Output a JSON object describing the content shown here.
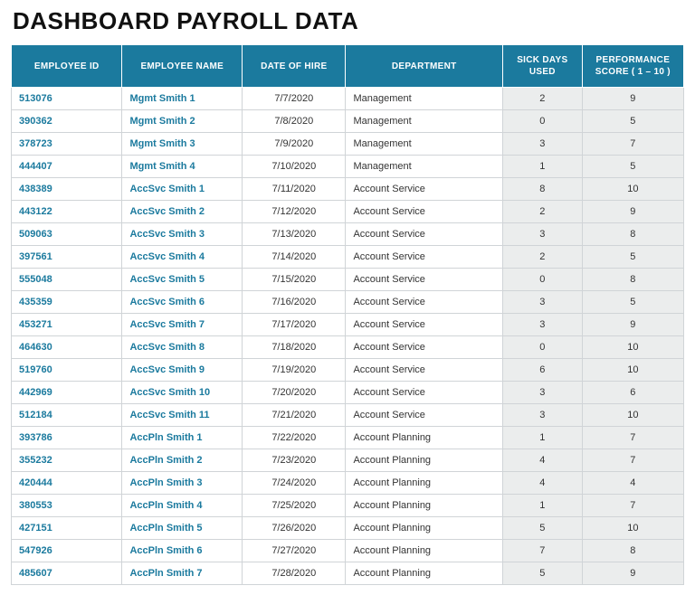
{
  "title": "DASHBOARD PAYROLL DATA",
  "headers": {
    "employee_id": "EMPLOYEE ID",
    "employee_name": "EMPLOYEE NAME",
    "date_of_hire": "DATE OF HIRE",
    "department": "DEPARTMENT",
    "sick_days": "SICK DAYS USED",
    "performance": "PERFORMANCE SCORE ( 1 – 10 )"
  },
  "rows": [
    {
      "id": "513076",
      "name": "Mgmt Smith 1",
      "date": "7/7/2020",
      "dept": "Management",
      "sick": "2",
      "perf": "9"
    },
    {
      "id": "390362",
      "name": "Mgmt Smith 2",
      "date": "7/8/2020",
      "dept": "Management",
      "sick": "0",
      "perf": "5"
    },
    {
      "id": "378723",
      "name": "Mgmt Smith 3",
      "date": "7/9/2020",
      "dept": "Management",
      "sick": "3",
      "perf": "7"
    },
    {
      "id": "444407",
      "name": "Mgmt Smith 4",
      "date": "7/10/2020",
      "dept": "Management",
      "sick": "1",
      "perf": "5"
    },
    {
      "id": "438389",
      "name": "AccSvc Smith 1",
      "date": "7/11/2020",
      "dept": "Account Service",
      "sick": "8",
      "perf": "10"
    },
    {
      "id": "443122",
      "name": "AccSvc Smith 2",
      "date": "7/12/2020",
      "dept": "Account Service",
      "sick": "2",
      "perf": "9"
    },
    {
      "id": "509063",
      "name": "AccSvc Smith 3",
      "date": "7/13/2020",
      "dept": "Account Service",
      "sick": "3",
      "perf": "8"
    },
    {
      "id": "397561",
      "name": "AccSvc Smith 4",
      "date": "7/14/2020",
      "dept": "Account Service",
      "sick": "2",
      "perf": "5"
    },
    {
      "id": "555048",
      "name": "AccSvc Smith 5",
      "date": "7/15/2020",
      "dept": "Account Service",
      "sick": "0",
      "perf": "8"
    },
    {
      "id": "435359",
      "name": "AccSvc Smith 6",
      "date": "7/16/2020",
      "dept": "Account Service",
      "sick": "3",
      "perf": "5"
    },
    {
      "id": "453271",
      "name": "AccSvc Smith 7",
      "date": "7/17/2020",
      "dept": "Account Service",
      "sick": "3",
      "perf": "9"
    },
    {
      "id": "464630",
      "name": "AccSvc Smith 8",
      "date": "7/18/2020",
      "dept": "Account Service",
      "sick": "0",
      "perf": "10"
    },
    {
      "id": "519760",
      "name": "AccSvc Smith 9",
      "date": "7/19/2020",
      "dept": "Account Service",
      "sick": "6",
      "perf": "10"
    },
    {
      "id": "442969",
      "name": "AccSvc Smith 10",
      "date": "7/20/2020",
      "dept": "Account Service",
      "sick": "3",
      "perf": "6"
    },
    {
      "id": "512184",
      "name": "AccSvc Smith 11",
      "date": "7/21/2020",
      "dept": "Account Service",
      "sick": "3",
      "perf": "10"
    },
    {
      "id": "393786",
      "name": "AccPln Smith 1",
      "date": "7/22/2020",
      "dept": "Account Planning",
      "sick": "1",
      "perf": "7"
    },
    {
      "id": "355232",
      "name": "AccPln Smith 2",
      "date": "7/23/2020",
      "dept": "Account Planning",
      "sick": "4",
      "perf": "7"
    },
    {
      "id": "420444",
      "name": "AccPln Smith 3",
      "date": "7/24/2020",
      "dept": "Account Planning",
      "sick": "4",
      "perf": "4"
    },
    {
      "id": "380553",
      "name": "AccPln Smith 4",
      "date": "7/25/2020",
      "dept": "Account Planning",
      "sick": "1",
      "perf": "7"
    },
    {
      "id": "427151",
      "name": "AccPln Smith 5",
      "date": "7/26/2020",
      "dept": "Account Planning",
      "sick": "5",
      "perf": "10"
    },
    {
      "id": "547926",
      "name": "AccPln Smith 6",
      "date": "7/27/2020",
      "dept": "Account Planning",
      "sick": "7",
      "perf": "8"
    },
    {
      "id": "485607",
      "name": "AccPln Smith 7",
      "date": "7/28/2020",
      "dept": "Account Planning",
      "sick": "5",
      "perf": "9"
    }
  ]
}
